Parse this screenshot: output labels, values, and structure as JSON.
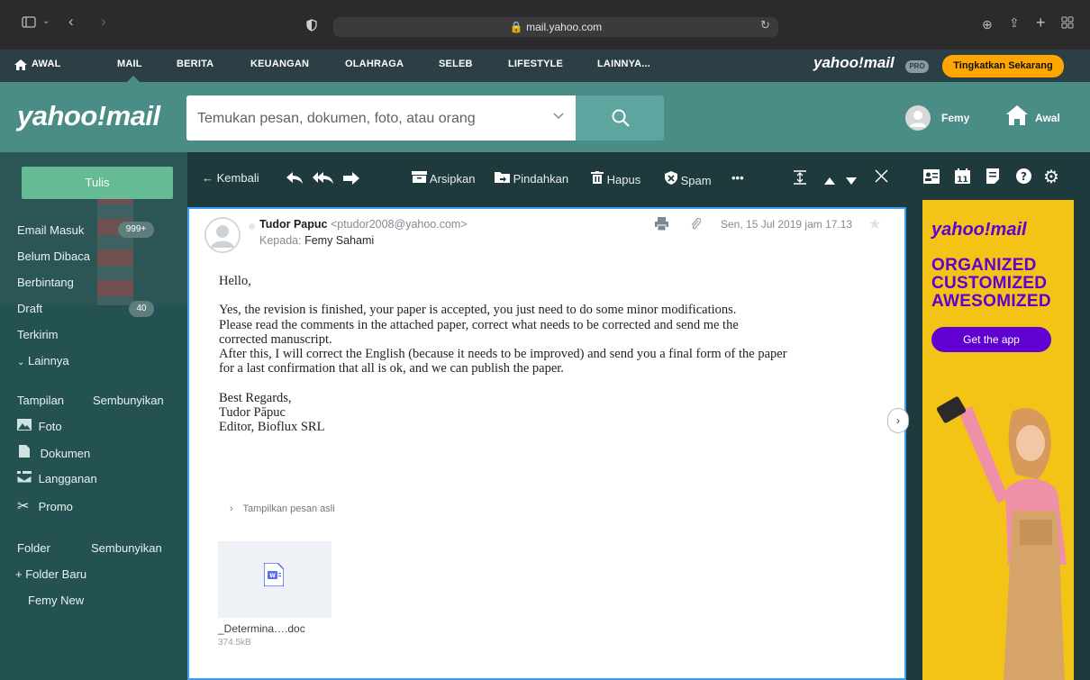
{
  "browser": {
    "url": "mail.yahoo.com"
  },
  "topnav": {
    "items": [
      "AWAL",
      "MAIL",
      "BERITA",
      "KEUANGAN",
      "OLAHRAGA",
      "SELEB",
      "LIFESTYLE",
      "LAINNYA..."
    ],
    "brand": "yahoo!mail",
    "pro_badge": "PRO",
    "upgrade_label": "Tingkatkan Sekarang"
  },
  "header": {
    "logo": "yahoo!mail",
    "search_placeholder": "Temukan pesan, dokumen, foto, atau orang",
    "user_name": "Femy",
    "home_label": "Awal"
  },
  "sidebar": {
    "compose": "Tulis",
    "items": [
      {
        "label": "Email Masuk",
        "badge": "999+"
      },
      {
        "label": "Belum Dibaca"
      },
      {
        "label": "Berbintang"
      },
      {
        "label": "Draft",
        "badge": "40"
      },
      {
        "label": "Terkirim"
      },
      {
        "label": "Lainnya"
      }
    ],
    "views_title": "Tampilan",
    "views_toggle": "Sembunyikan",
    "views": [
      "Foto",
      "Dokumen",
      "Langganan",
      "Promo"
    ],
    "folders_title": "Folder",
    "folders_toggle": "Sembunyikan",
    "new_folder": "+ Folder Baru",
    "folders": [
      "Femy New"
    ]
  },
  "toolbar": {
    "back": "Kembali",
    "archive": "Arsipkan",
    "move": "Pindahkan",
    "delete": "Hapus",
    "spam": "Spam",
    "more": "•••"
  },
  "email": {
    "sender_name": "Tudor Papuc",
    "sender_email": "<ptudor2008@yahoo.com>",
    "to_label": "Kepada:",
    "to_name": "Femy Sahami",
    "date": "Sen, 15 Jul 2019 jam 17.13",
    "body": [
      "Hello,",
      "",
      "Yes, the revision is finished, your paper is accepted, you just need to do some minor modifications.",
      "Please read the comments in the attached paper, correct what needs to be corrected and send me the",
      "corrected manuscript.",
      "After this, I will correct the English (because it needs to be improved) and send you a final form of the paper",
      "for a last confirmation that all is ok, and we can publish the paper.",
      "",
      "Best Regards,",
      "Tudor Păpuc",
      "Editor, Bioflux SRL"
    ],
    "show_original": "Tampilkan pesan asli",
    "attachment": {
      "name": "_Determina….doc",
      "size": "374.5kB"
    }
  },
  "ad": {
    "logo": "yahoo!mail",
    "lines": [
      "ORGANIZED",
      "CUSTOMIZED",
      "AWESOMIZED"
    ],
    "cta": "Get the app"
  }
}
